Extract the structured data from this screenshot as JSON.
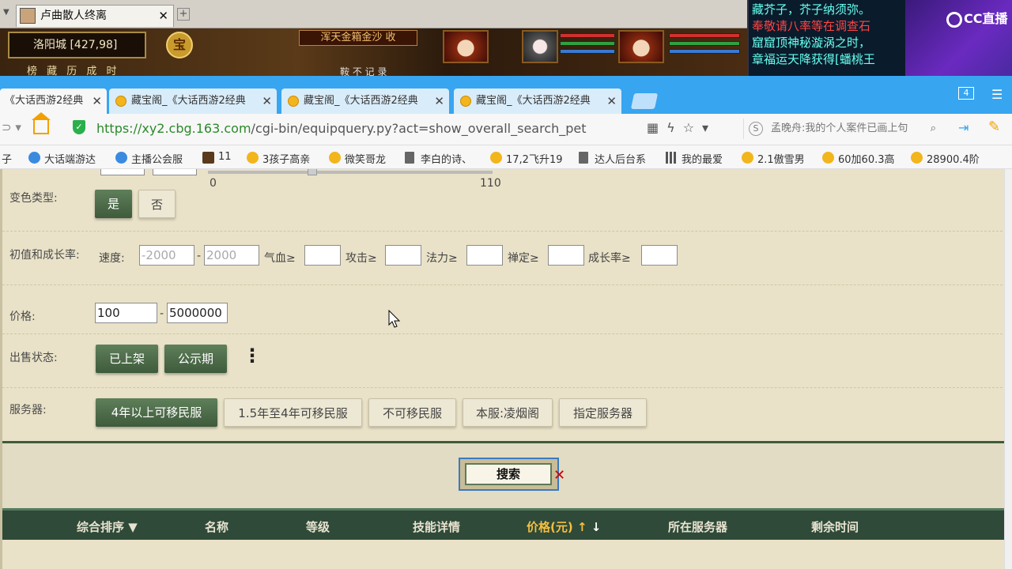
{
  "game": {
    "tab_title": "卢曲散人终离",
    "map_name": "洛阳城 [427,98]",
    "coin_label": "宝",
    "notice": "浑天金箱金沙 收",
    "menu": "榜 藏 历 成 时",
    "bottom": "鞍 不 记 录"
  },
  "chat": {
    "lines": [
      "藏芥子，芥子纳须弥。",
      "奉敬请八率等在调查石",
      "窟窟顶神秘漩涡之时，",
      "章福运天降获得[蟠桃王"
    ]
  },
  "cc": {
    "logo": "CC直播"
  },
  "browser": {
    "tabs": [
      {
        "label": "《大话西游2经典",
        "active": true
      },
      {
        "label": "藏宝阁_《大话西游2经典",
        "active": false
      },
      {
        "label": "藏宝阁_《大话西游2经典",
        "active": false
      },
      {
        "label": "藏宝阁_《大话西游2经典",
        "active": false
      }
    ],
    "tab_count": "4",
    "url_host": "https://xy2.cbg.163.com",
    "url_path": "/cgi-bin/equipquery.py?act=show_overall_search_pet",
    "search_text": "孟晚舟:我的个人案件已画上句",
    "bookmarks": [
      "子",
      "大话端游达",
      "主播公会服",
      "11",
      "3孩子高亲",
      "微笑哥龙",
      "李白的诗、",
      "17,2飞升19",
      "达人后台系",
      "我的最爱",
      "2.1傲雪男",
      "60加60.3高",
      "28900.4阶"
    ]
  },
  "form": {
    "slider_min": "0",
    "slider_max": "110",
    "color_type": {
      "label": "变色类型:",
      "yes": "是",
      "no": "否"
    },
    "init": {
      "label": "初值和成长率:",
      "speed_label": "速度:",
      "speed_min": "-2000",
      "speed_max": "2000",
      "hp_label": "气血≥",
      "atk_label": "攻击≥",
      "mp_label": "法力≥",
      "zen_label": "禅定≥",
      "growth_label": "成长率≥",
      "dash": "-"
    },
    "price": {
      "label": "价格:",
      "min": "100",
      "max": "5000000",
      "dash": "-"
    },
    "sale": {
      "label": "出售状态:",
      "listed": "已上架",
      "public": "公示期",
      "more": "⋮"
    },
    "server": {
      "label": "服务器:",
      "options": [
        "4年以上可移民服",
        "1.5年至4年可移民服",
        "不可移民服",
        "本服:凌烟阁",
        "指定服务器"
      ]
    },
    "search_button": "搜索"
  },
  "table_header": {
    "sort": "综合排序 ▼",
    "name": "名称",
    "level": "等级",
    "skills": "技能详情",
    "price": "价格(元)",
    "price_up": "↑",
    "price_down": "↓",
    "server": "所在服务器",
    "time_left": "剩余时间"
  }
}
